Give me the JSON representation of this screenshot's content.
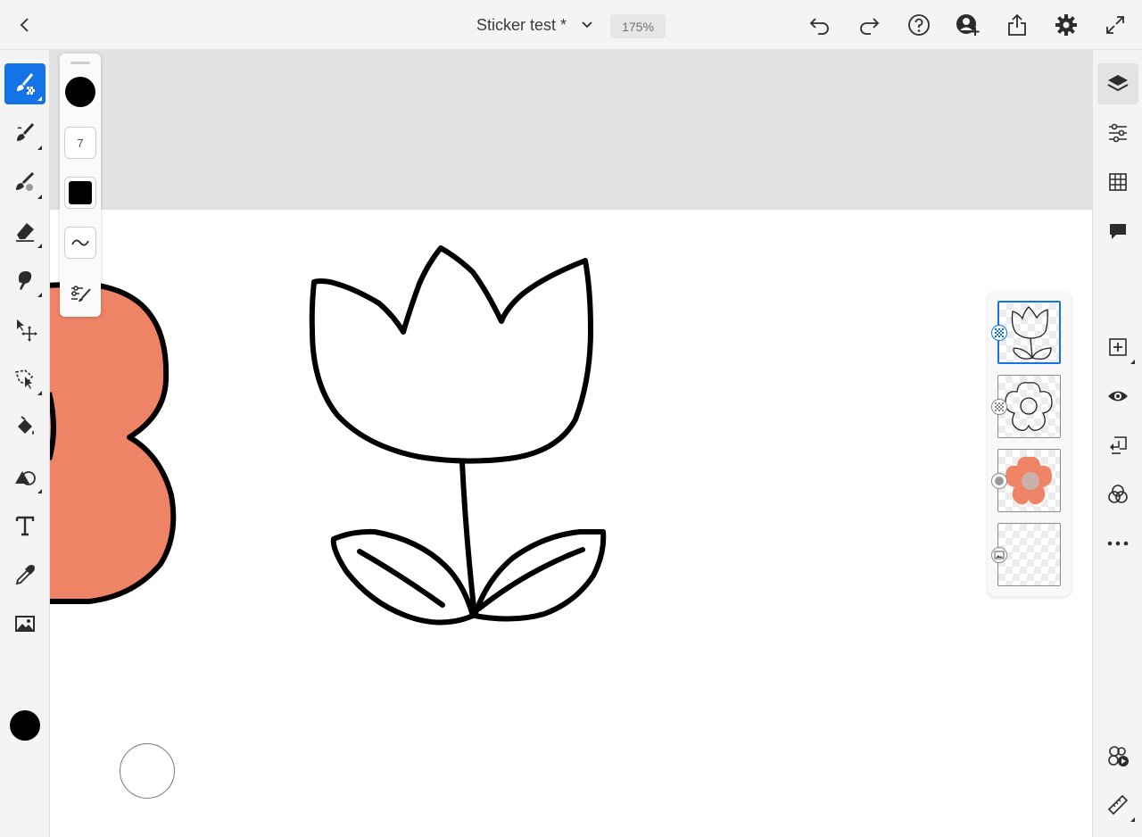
{
  "header": {
    "title": "Sticker test *",
    "zoom": "175%"
  },
  "brush_panel": {
    "size": "7",
    "color": "#000000"
  },
  "colors": {
    "accent": "#1473e6",
    "flower_fill": "#ee8465",
    "current_color": "#000000"
  },
  "left_toolbar": {
    "tools": [
      "pixel-brush",
      "live-brush",
      "mixer-brush",
      "eraser",
      "smudge",
      "move",
      "lasso-select",
      "fill",
      "shapes",
      "text",
      "eyedropper",
      "image"
    ]
  },
  "right_toolbar": {
    "tools": [
      "layers",
      "layer-properties",
      "grid",
      "comments",
      "add-layer",
      "visibility",
      "merge-down",
      "blend-mode",
      "more",
      "livestream",
      "ruler"
    ]
  },
  "layers": {
    "items": [
      {
        "type": "drawing",
        "name": "tulip"
      },
      {
        "type": "drawing",
        "name": "flower-outline"
      },
      {
        "type": "paint",
        "name": "flower-fill"
      },
      {
        "type": "image",
        "name": "background"
      }
    ]
  }
}
